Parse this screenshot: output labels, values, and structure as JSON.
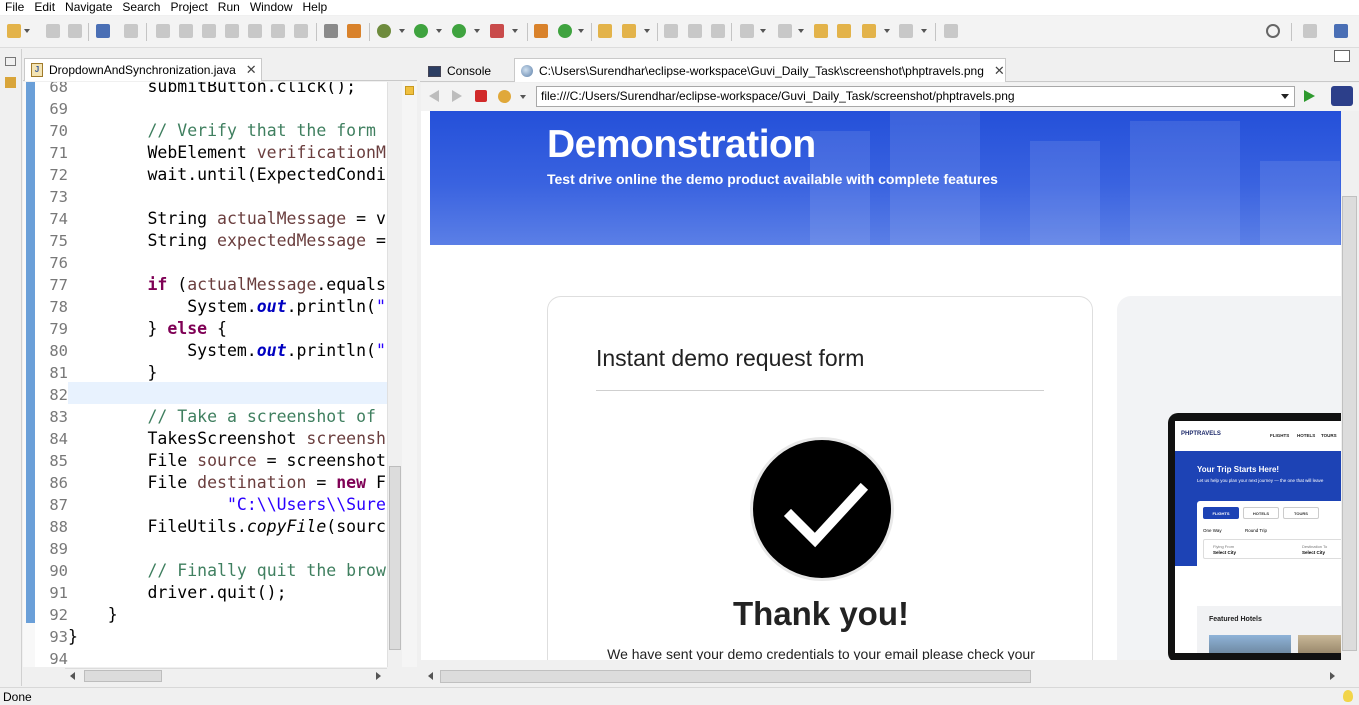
{
  "menu": [
    "File",
    "Edit",
    "Navigate",
    "Search",
    "Project",
    "Run",
    "Window",
    "Help"
  ],
  "editor": {
    "tab_label": "DropdownAndSynchronization.java",
    "lines": [
      {
        "n": "68",
        "html": "        submitButton.click();"
      },
      {
        "n": "69",
        "html": ""
      },
      {
        "n": "70",
        "html": "        <span class='cm'>// Verify that the form</span>"
      },
      {
        "n": "71",
        "html": "        WebElement <span class='var'>verificationM</span>"
      },
      {
        "n": "72",
        "html": "        wait.until(ExpectedCondi"
      },
      {
        "n": "73",
        "html": ""
      },
      {
        "n": "74",
        "html": "        String <span class='var'>actualMessage</span> = v"
      },
      {
        "n": "75",
        "html": "        String <span class='var'>expectedMessage</span> ="
      },
      {
        "n": "76",
        "html": ""
      },
      {
        "n": "77",
        "html": "        <span class='kw'>if</span> (<span class='var'>actualMessage</span>.equals"
      },
      {
        "n": "78",
        "html": "            System.<span class='fld'>out</span>.println(<span class='str'>\"</span>"
      },
      {
        "n": "79",
        "html": "        } <span class='kw'>else</span> {"
      },
      {
        "n": "80",
        "html": "            System.<span class='fld'>out</span>.println(<span class='str'>\"</span>"
      },
      {
        "n": "81",
        "html": "        }"
      },
      {
        "n": "82",
        "html": ""
      },
      {
        "n": "83",
        "html": "        <span class='cm'>// Take a screenshot of</span>"
      },
      {
        "n": "84",
        "html": "        TakesScreenshot <span class='var'>screensh</span>"
      },
      {
        "n": "85",
        "html": "        File <span class='var'>source</span> = screenshot"
      },
      {
        "n": "86",
        "html": "        File <span class='var'>destination</span> = <span class='kw'>new</span> F"
      },
      {
        "n": "87",
        "html": "                <span class='str'>\"C:\\\\Users\\\\Sure</span>"
      },
      {
        "n": "88",
        "html": "        FileUtils.<span class='it'>copyFile</span>(sourc"
      },
      {
        "n": "89",
        "html": ""
      },
      {
        "n": "90",
        "html": "        <span class='cm'>// Finally quit the brow</span>"
      },
      {
        "n": "91",
        "html": "        driver.quit();"
      },
      {
        "n": "92",
        "html": "    }"
      },
      {
        "n": "93",
        "html": "}"
      },
      {
        "n": "94",
        "html": ""
      }
    ]
  },
  "right_tabs": {
    "console_label": "Console",
    "image_tab_label": "C:\\Users\\Surendhar\\eclipse-workspace\\Guvi_Daily_Task\\screenshot\\phptravels.png"
  },
  "browser": {
    "url": "file:///C:/Users/Surendhar/eclipse-workspace/Guvi_Daily_Task/screenshot/phptravels.png"
  },
  "page": {
    "hero_title": "Demonstration",
    "hero_subtitle": "Test drive online the demo product available with complete features",
    "form_title": "Instant demo request form",
    "thanks": "Thank you!",
    "sent_message": "We have sent your demo credentials to your email please check your",
    "laptop": {
      "logo": "PHPTRAVELS",
      "nav": [
        "FLIGHTS",
        "HOTELS",
        "TOURS"
      ],
      "trip_title": "Your Trip Starts Here!",
      "trip_sub": "Let us help you plan your next journey — the one that will leave",
      "tabs": [
        "FLIGHTS",
        "HOTELS",
        "TOURS"
      ],
      "one_way": "One Way",
      "round_trip": "Round Trip",
      "from_label": "Flying From",
      "from_value": "Select City",
      "to_label": "Destination To",
      "to_value": "Select City",
      "featured": "Featured Hotels"
    }
  },
  "status": {
    "text": "Done"
  }
}
